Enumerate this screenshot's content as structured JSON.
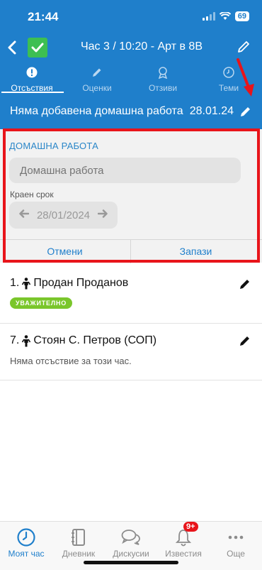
{
  "status_bar": {
    "time": "21:44",
    "battery": "69"
  },
  "toolbar": {
    "title": "Час 3 / 10:20 - Арт в 8В"
  },
  "tabs": [
    {
      "label": "Отсъствия",
      "icon": "exclamation-icon",
      "active": true
    },
    {
      "label": "Оценки",
      "icon": "pencil-icon",
      "active": false
    },
    {
      "label": "Отзиви",
      "icon": "award-icon",
      "active": false
    },
    {
      "label": "Теми",
      "icon": "clock-icon",
      "active": false
    }
  ],
  "homework_bar": {
    "status": "Няма добавена домашна работа",
    "date": "28.01.24"
  },
  "form": {
    "heading": "ДОМАШНА РАБОТА",
    "homework_placeholder": "Домашна работа",
    "deadline_label": "Краен срок",
    "deadline_value": "28/01/2024",
    "cancel_label": "Отмени",
    "save_label": "Запази"
  },
  "students": [
    {
      "number": "1.",
      "name": "Продан Проданов",
      "badge": "УВАЖИТЕЛНО",
      "note": ""
    },
    {
      "number": "7.",
      "name": "Стоян С. Петров (СОП)",
      "badge": "",
      "note": "Няма отсъствие за този час."
    }
  ],
  "bottom_nav": [
    {
      "label": "Моят час",
      "icon": "clock-icon",
      "active": true
    },
    {
      "label": "Дневник",
      "icon": "notebook-icon",
      "active": false
    },
    {
      "label": "Дискусии",
      "icon": "chat-icon",
      "active": false
    },
    {
      "label": "Известия",
      "icon": "bell-icon",
      "active": false,
      "badge": "9+"
    },
    {
      "label": "Още",
      "icon": "more-icon",
      "active": false
    }
  ],
  "colors": {
    "primary": "#1f7fcb",
    "success": "#3dbf52",
    "highlight": "#e8141a",
    "badge_green": "#7ac62b"
  }
}
